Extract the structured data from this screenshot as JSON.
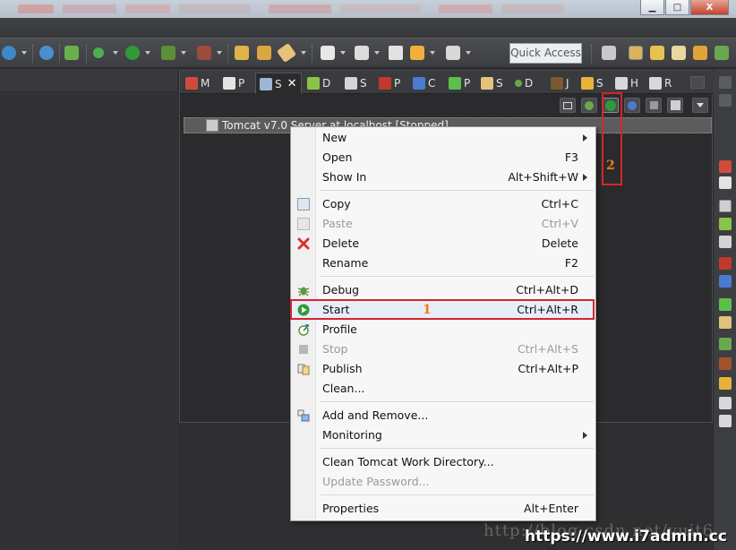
{
  "window": {
    "minimize": "▁",
    "maximize": "□",
    "close": "X"
  },
  "toolbar": {
    "quick_access": "Quick Access"
  },
  "tabs": [
    {
      "label": "M",
      "icon": "markers-icon"
    },
    {
      "label": "P",
      "icon": "properties-icon"
    },
    {
      "label": "S",
      "icon": "servers-icon",
      "active": true
    },
    {
      "label": "D",
      "icon": "data-source-icon"
    },
    {
      "label": "S",
      "icon": "snippets-icon"
    },
    {
      "label": "P",
      "icon": "problems-icon"
    },
    {
      "label": "C",
      "icon": "console-icon"
    },
    {
      "label": "P",
      "icon": "progress-icon"
    },
    {
      "label": "S",
      "icon": "search-icon"
    },
    {
      "label": "D",
      "icon": "debug-icon"
    },
    {
      "label": "J",
      "icon": "junit-icon"
    },
    {
      "label": "S",
      "icon": "synchronize-icon"
    },
    {
      "label": "H",
      "icon": "history-icon"
    },
    {
      "label": "R",
      "icon": "remote-icon"
    }
  ],
  "tab_close": "✕",
  "server_row": "Tomcat v7.0 Server at localhost  [Stopped]",
  "menu": {
    "new": {
      "label": "New"
    },
    "open": {
      "label": "Open",
      "shortcut": "F3"
    },
    "show_in": {
      "label": "Show In",
      "shortcut": "Alt+Shift+W"
    },
    "copy": {
      "label": "Copy",
      "shortcut": "Ctrl+C"
    },
    "paste": {
      "label": "Paste",
      "shortcut": "Ctrl+V"
    },
    "delete": {
      "label": "Delete",
      "shortcut": "Delete"
    },
    "rename": {
      "label": "Rename",
      "shortcut": "F2"
    },
    "debug": {
      "label": "Debug",
      "shortcut": "Ctrl+Alt+D"
    },
    "start": {
      "label": "Start",
      "shortcut": "Ctrl+Alt+R"
    },
    "profile": {
      "label": "Profile"
    },
    "stop": {
      "label": "Stop",
      "shortcut": "Ctrl+Alt+S"
    },
    "publish": {
      "label": "Publish",
      "shortcut": "Ctrl+Alt+P"
    },
    "clean": {
      "label": "Clean..."
    },
    "add_remove": {
      "label": "Add and Remove..."
    },
    "monitoring": {
      "label": "Monitoring"
    },
    "clean_work_dir": {
      "label": "Clean Tomcat Work Directory..."
    },
    "update_password": {
      "label": "Update Password..."
    },
    "properties": {
      "label": "Properties",
      "shortcut": "Alt+Enter"
    }
  },
  "annotations": {
    "step1": "1",
    "step2": "2"
  },
  "watermarks": {
    "faint": "http://blog.csdn.net/yuit6",
    "bold": "https://www.i7admin.cc"
  },
  "colors": {
    "annotation_red": "#d2262c",
    "annotation_orange": "#f47a1a",
    "start_green": "#2e9a3a"
  }
}
